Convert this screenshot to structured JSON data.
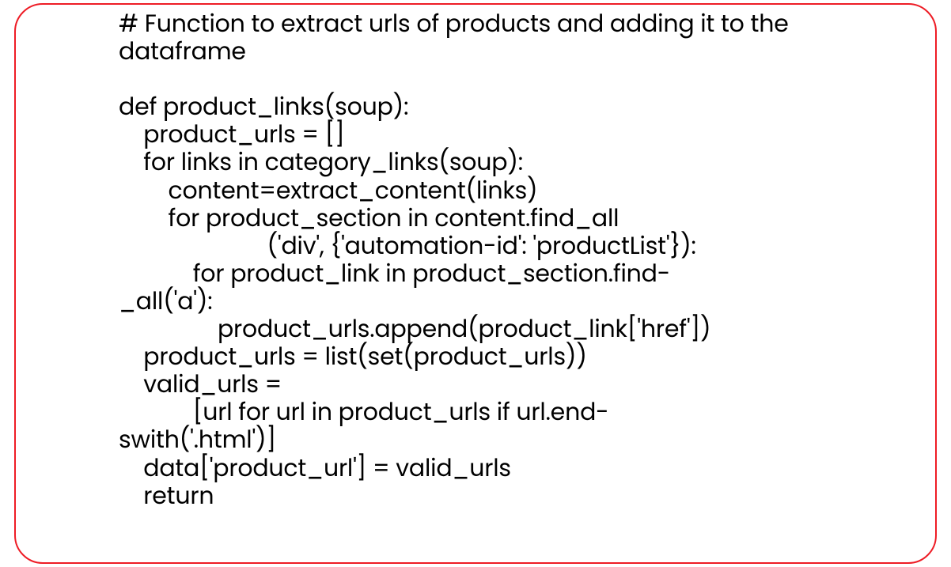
{
  "code_lines": [
    "# Function to extract urls of products and adding it to the dataframe",
    "",
    "def product_links(soup):",
    "    product_urls = []",
    "    for links in category_links(soup):",
    "        content=extract_content(links)",
    "        for product_section in content.find_all",
    "                        ('div', {'automation-id': 'productList'}):",
    "            for product_link in product_section.find-",
    "_all('a'):",
    "                product_urls.append(product_link['href'])",
    "    product_urls = list(set(product_urls))",
    "    valid_urls =",
    "            [url for url in product_urls if url.end-",
    "swith('.html')]",
    "    data['product_url'] = valid_urls",
    "    return"
  ]
}
